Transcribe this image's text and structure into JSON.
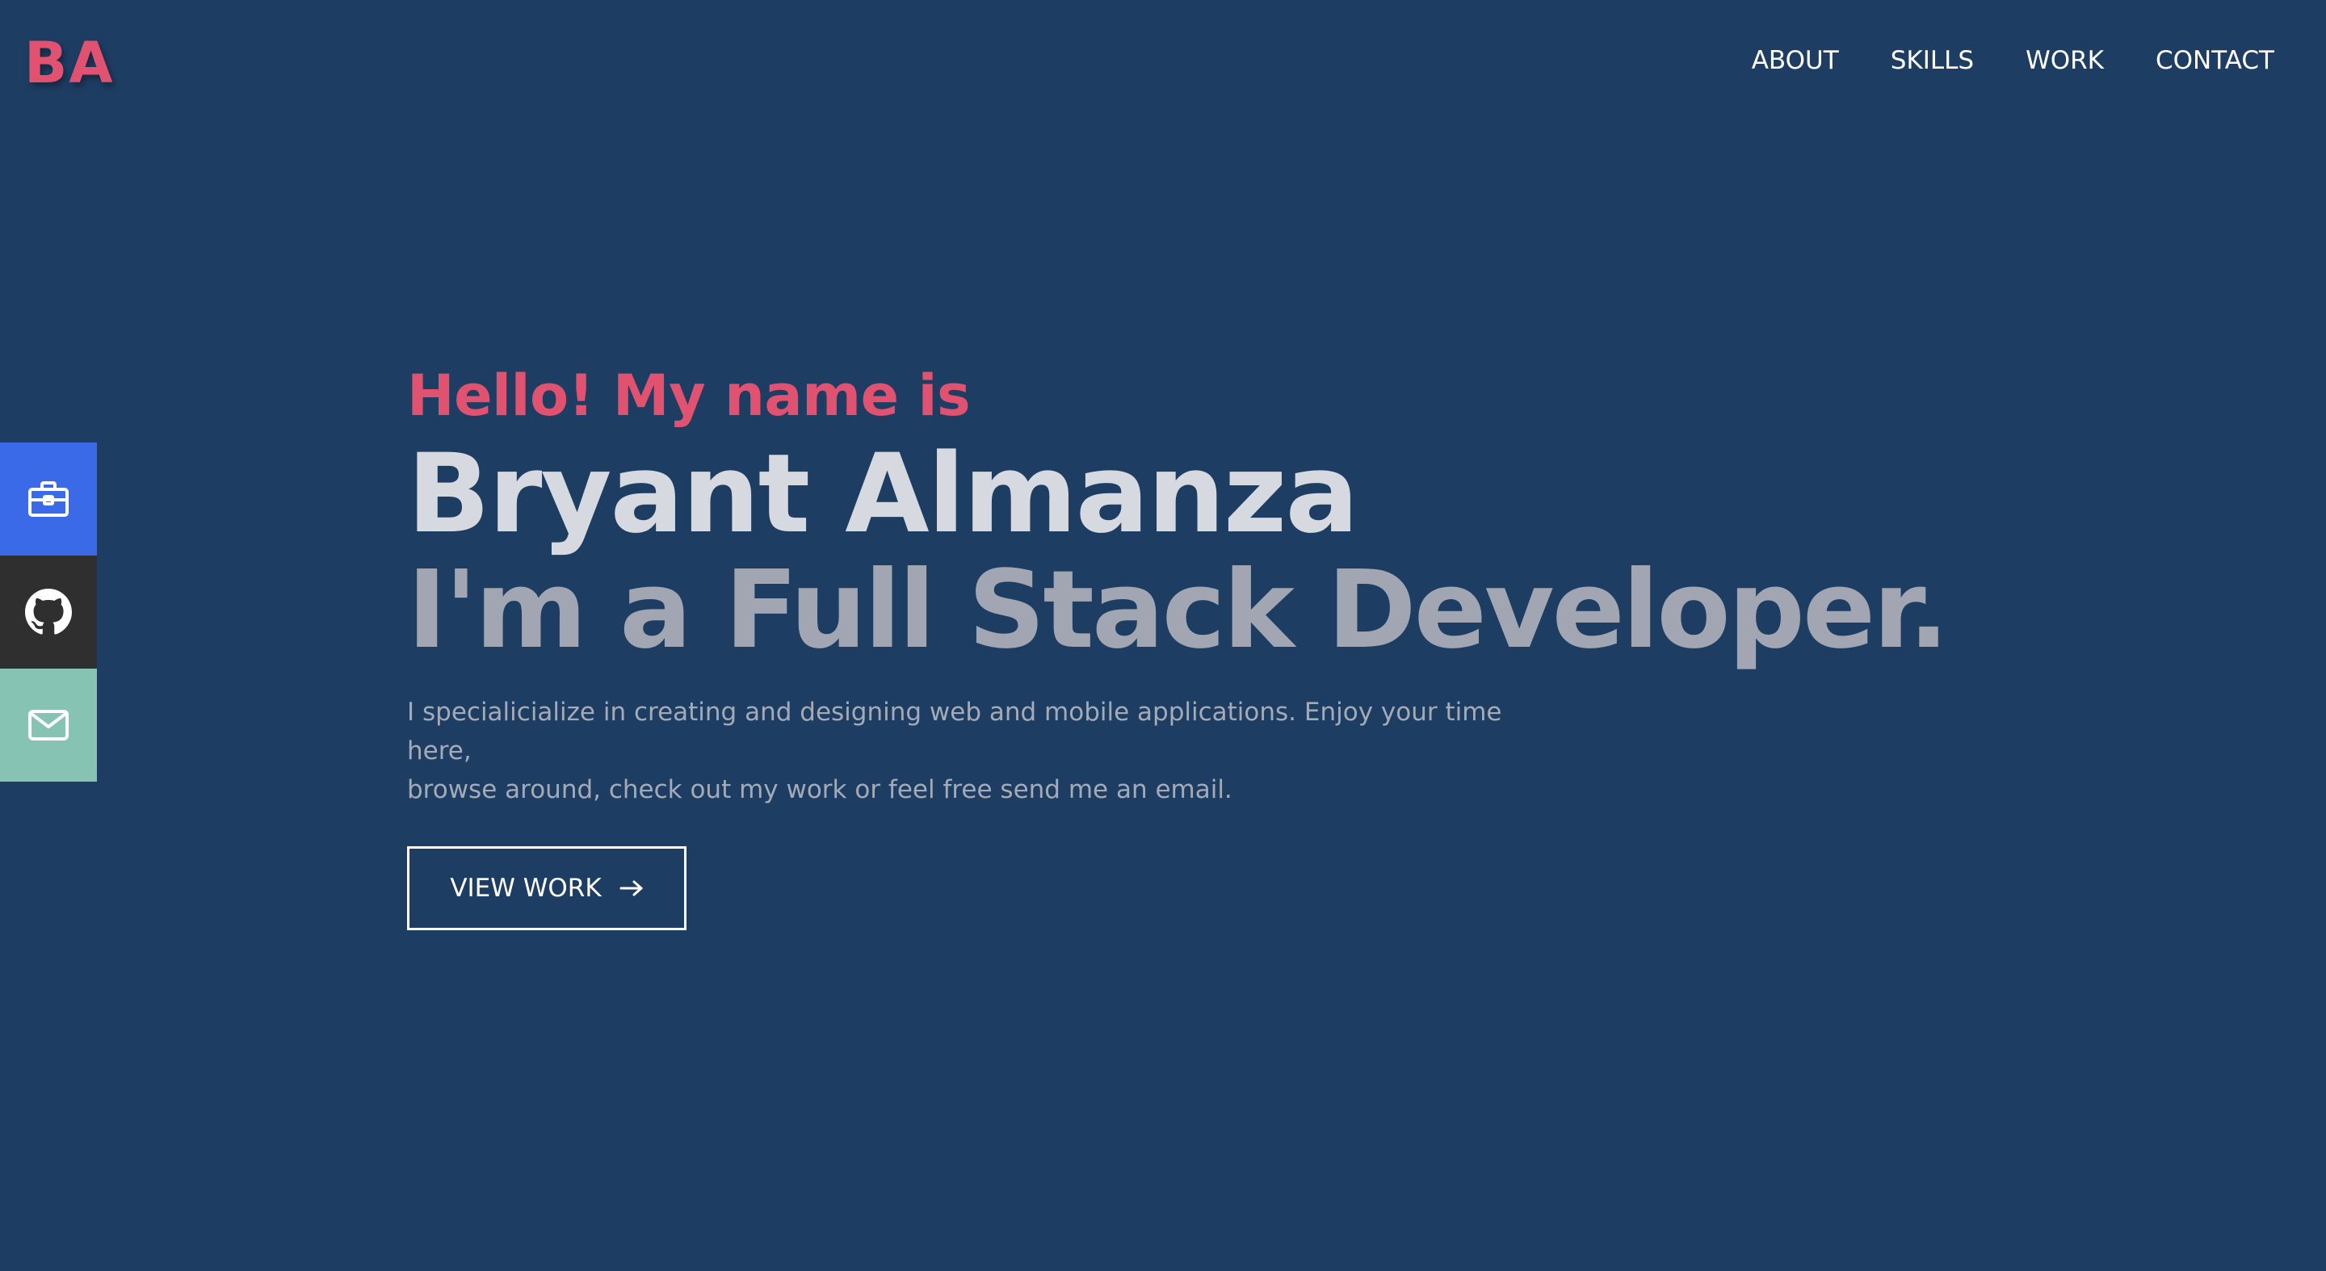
{
  "header": {
    "logo": "BA",
    "nav": [
      {
        "label": "ABOUT"
      },
      {
        "label": "SKILLS"
      },
      {
        "label": "WORK"
      },
      {
        "label": "CONTACT"
      }
    ]
  },
  "social": [
    {
      "icon": "briefcase-icon",
      "color": "#3a6ae8"
    },
    {
      "icon": "github-icon",
      "color": "#2f2f30"
    },
    {
      "icon": "mail-icon",
      "color": "#86c3b2"
    }
  ],
  "hero": {
    "greeting": "Hello! My name is",
    "name": "Bryant Almanza",
    "role": "I'm a Full Stack Developer.",
    "intro_line1": "I specialicialize in creating and designing web and mobile applications. Enjoy your time here,",
    "intro_line2": "browse around, check out my work or feel free send me an email.",
    "cta_label": "VIEW WORK",
    "cta_icon": "arrow-right-icon"
  },
  "colors": {
    "background": "#1e3d63",
    "accent": "#e0526f",
    "name_text": "#d6d9e0",
    "role_text": "#a1a6b2",
    "body_text": "#a4abb7"
  }
}
